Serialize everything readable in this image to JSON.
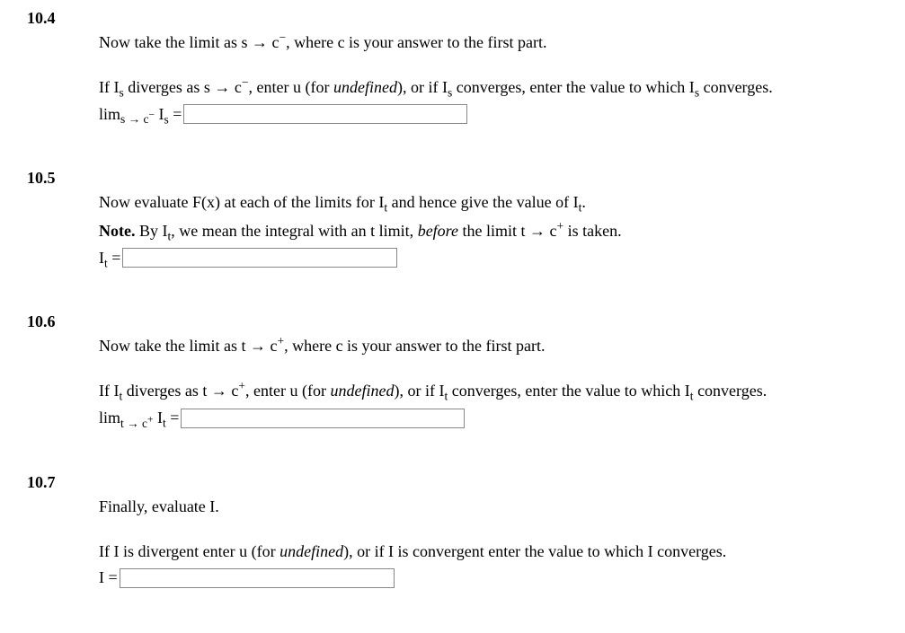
{
  "q104": {
    "number": "10.4",
    "line1_a": "Now take the limit as s → c",
    "line1_b": ", where c is your answer to the first part.",
    "line2_a": "If I",
    "line2_b": " diverges as s → c",
    "line2_c": ", enter u (for ",
    "line2_c_em": "undefined",
    "line2_d": "), or if I",
    "line2_e": " converges, enter the value to which I",
    "line2_f": " converges.",
    "prefix_a": "lim",
    "prefix_b": " I",
    "prefix_c": " = ",
    "sub_s": "s",
    "sub_limit": "s → c",
    "sup_minus": "−",
    "input_value": ""
  },
  "q105": {
    "number": "10.5",
    "line1_a": "Now evaluate F(x) at each of the limits for I",
    "line1_b": " and hence give the value of I",
    "line1_c": ".",
    "note_bold": "Note.",
    "note_a": " By I",
    "note_b": ", we mean the integral with an t limit, ",
    "note_em": "before",
    "note_c": " the limit t → c",
    "note_d": " is taken.",
    "prefix_a": "I",
    "prefix_b": " = ",
    "sub_t": "t",
    "sup_plus": "+",
    "input_value": ""
  },
  "q106": {
    "number": "10.6",
    "line1_a": "Now take the limit as t → c",
    "line1_b": ", where c is your answer to the first part.",
    "line2_a": "If I",
    "line2_b": " diverges as t → c",
    "line2_c": ", enter u (for ",
    "line2_c_em": "undefined",
    "line2_d": "), or if I",
    "line2_e": " converges, enter the value to which I",
    "line2_f": " converges.",
    "prefix_a": "lim",
    "prefix_b": " I",
    "prefix_c": " = ",
    "sub_t": "t",
    "sub_limit": "t → c",
    "sup_plus": "+",
    "input_value": ""
  },
  "q107": {
    "number": "10.7",
    "line1": "Finally, evaluate I.",
    "line2_a": "If I is divergent enter u (for ",
    "line2_em": "undefined",
    "line2_b": "), or if I is convergent enter the value to which I converges.",
    "prefix": "I = ",
    "input_value": ""
  }
}
